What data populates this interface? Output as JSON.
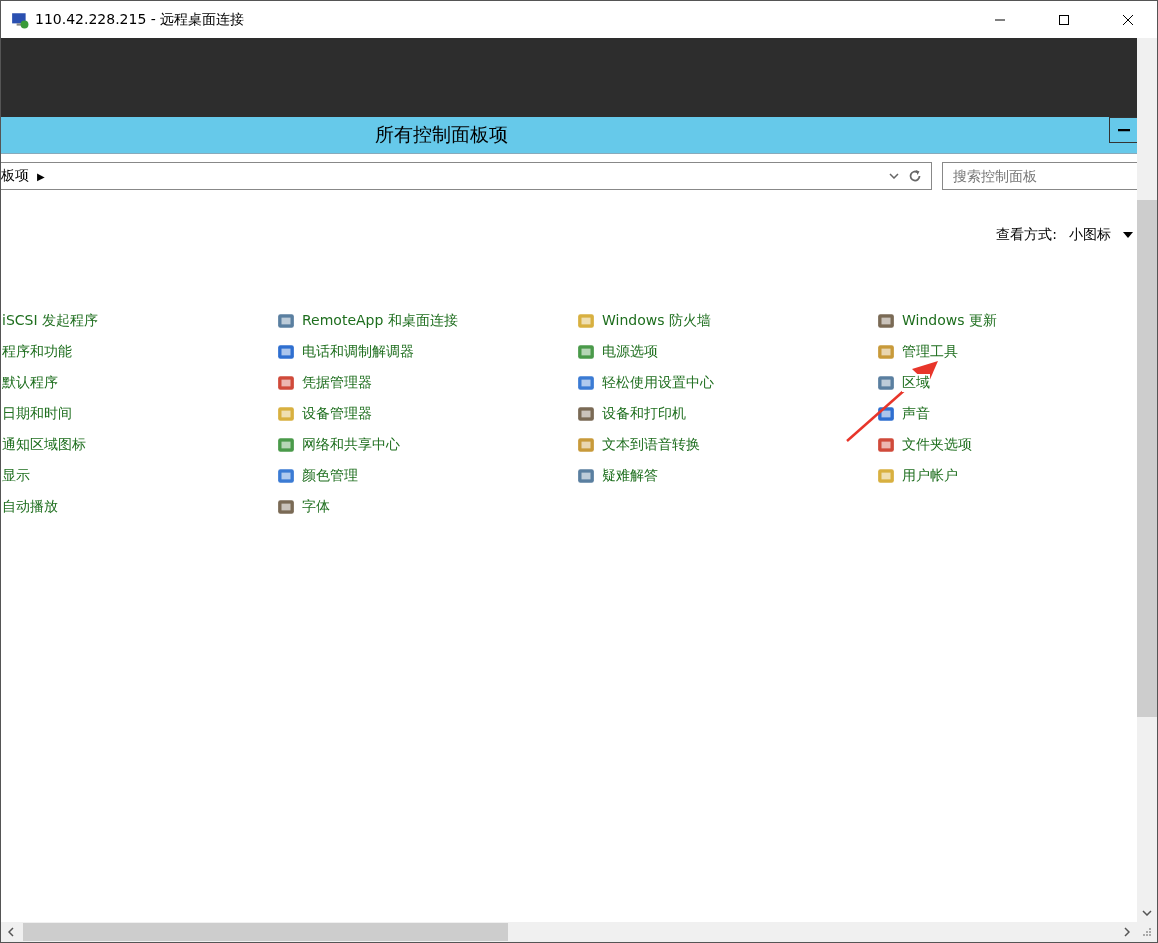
{
  "window": {
    "title": "110.42.228.215 - 远程桌面连接"
  },
  "panel": {
    "title": "所有控制面板项"
  },
  "address": {
    "path": "板项",
    "separator": "▶"
  },
  "search": {
    "placeholder": "搜索控制面板"
  },
  "view": {
    "label": "查看方式:",
    "value": "小图标"
  },
  "columns": [
    {
      "items": [
        "iSCSI 发起程序",
        "程序和功能",
        "默认程序",
        "日期和时间",
        "通知区域图标",
        "显示",
        "自动播放"
      ]
    },
    {
      "items": [
        "RemoteApp 和桌面连接",
        "电话和调制解调器",
        "凭据管理器",
        "设备管理器",
        "网络和共享中心",
        "颜色管理",
        "字体"
      ]
    },
    {
      "items": [
        "Windows 防火墙",
        "电源选项",
        "轻松使用设置中心",
        "设备和打印机",
        "文本到语音转换",
        "疑难解答"
      ]
    },
    {
      "items": [
        "Windows 更新",
        "管理工具",
        "区域",
        "声音",
        "文件夹选项",
        "用户帐户"
      ]
    }
  ]
}
